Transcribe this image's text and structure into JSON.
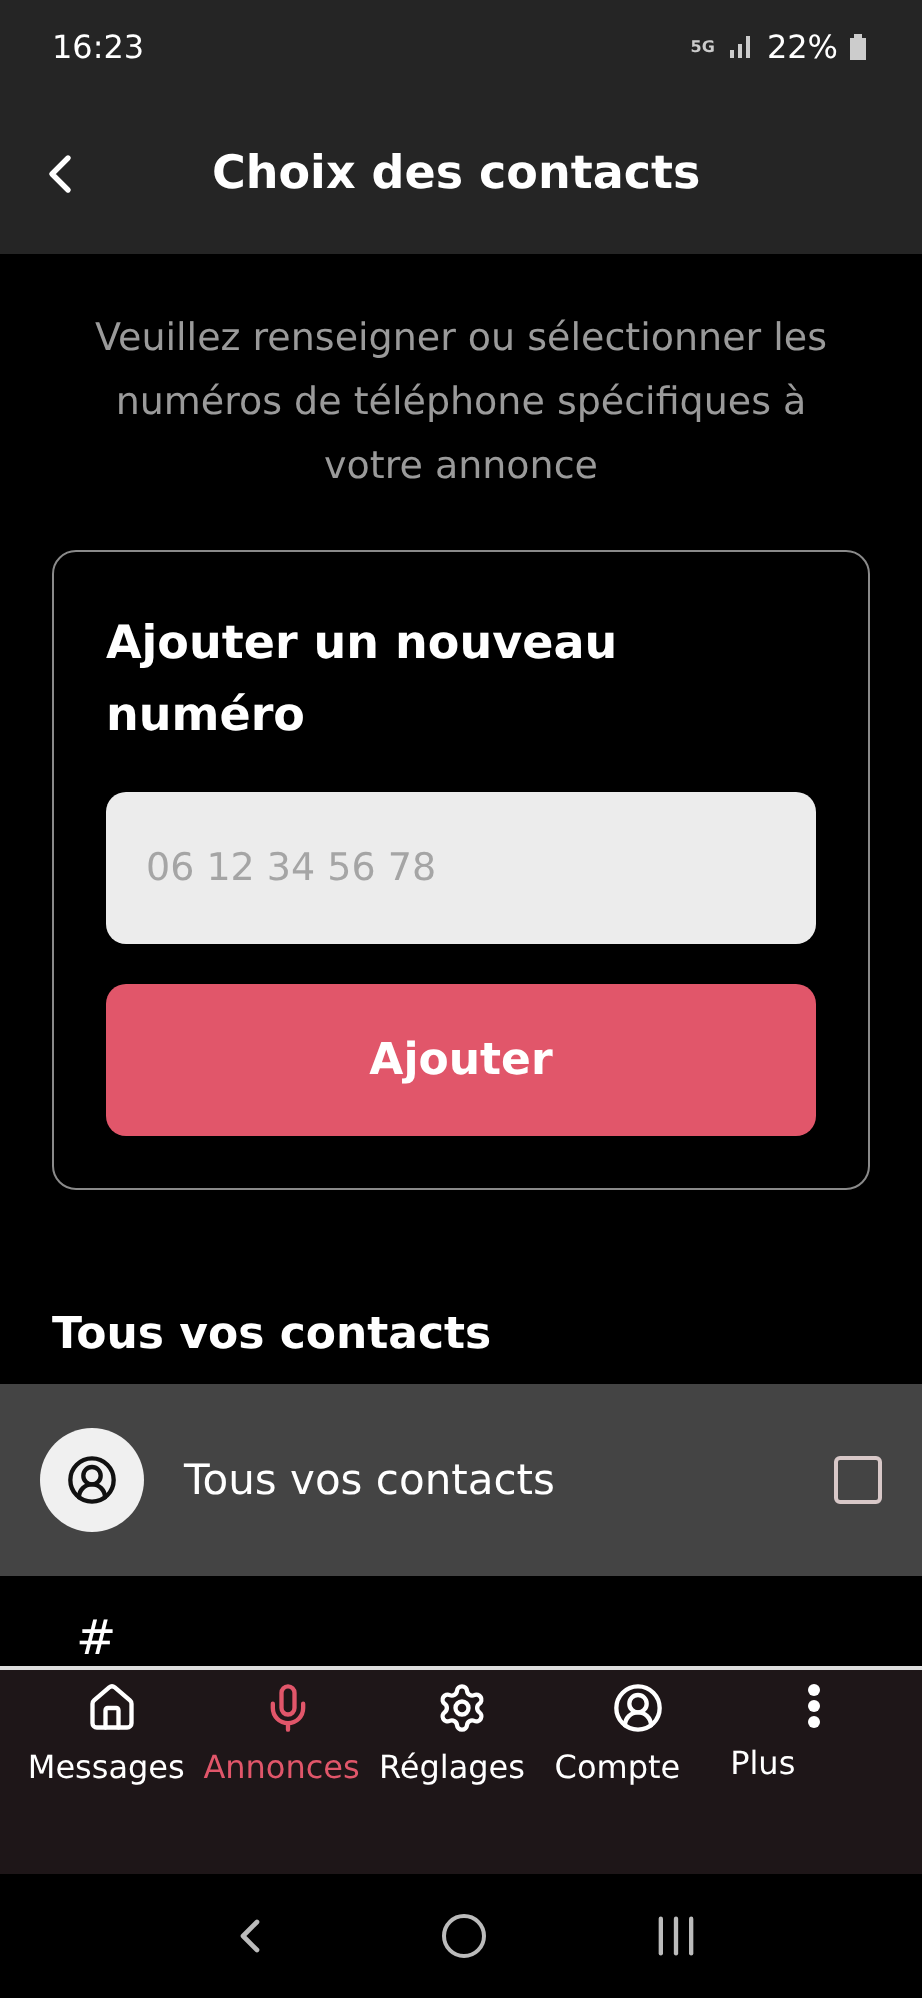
{
  "status_bar": {
    "time": "16:23",
    "network": "5G",
    "battery": "22%"
  },
  "header": {
    "title": "Choix des contacts"
  },
  "intro": "Veuillez renseigner ou sélectionner les numéros de téléphone spécifiques à votre annonce",
  "add_card": {
    "title": "Ajouter un nouveau numéro",
    "phone_field": {
      "placeholder": "06 12 34 56 78"
    },
    "button": "Ajouter"
  },
  "section_title": "Tous vos contacts",
  "contacts": [
    {
      "name": "Tous vos contacts",
      "checked": false
    }
  ],
  "group_letter": "#",
  "bottom_nav": [
    {
      "label": "Messages",
      "kind": "home",
      "selected": false
    },
    {
      "label": "Annonces",
      "kind": "mic",
      "selected": true
    },
    {
      "label": "Réglages",
      "kind": "gear",
      "selected": false
    },
    {
      "label": "Compte",
      "kind": "user",
      "selected": false
    },
    {
      "label": "Plus",
      "kind": "more",
      "selected": false
    }
  ]
}
